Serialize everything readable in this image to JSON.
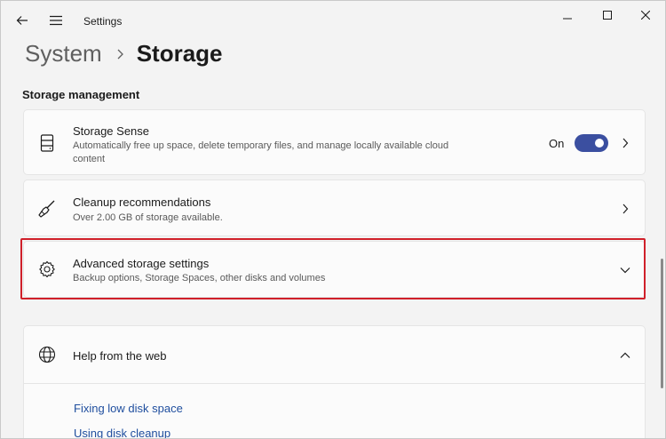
{
  "window": {
    "app_title": "Settings"
  },
  "breadcrumb": {
    "parent": "System",
    "current": "Storage"
  },
  "section": {
    "title": "Storage management"
  },
  "cards": {
    "storage_sense": {
      "title": "Storage Sense",
      "description": "Automatically free up space, delete temporary files, and manage locally available cloud content",
      "toggle_label": "On",
      "toggle_on": true,
      "icon": "storage-drive-icon"
    },
    "cleanup": {
      "title": "Cleanup recommendations",
      "description": "Over 2.00 GB of storage available.",
      "icon": "broom-icon"
    },
    "advanced": {
      "title": "Advanced storage settings",
      "description": "Backup options, Storage Spaces, other disks and volumes",
      "icon": "gear-icon"
    },
    "help": {
      "title": "Help from the web",
      "icon": "globe-icon",
      "links": [
        "Fixing low disk space",
        "Using disk cleanup"
      ]
    }
  },
  "colors": {
    "accent": "#3b4fa0",
    "highlight_border": "#d0202a",
    "link": "#1f4e9e"
  }
}
